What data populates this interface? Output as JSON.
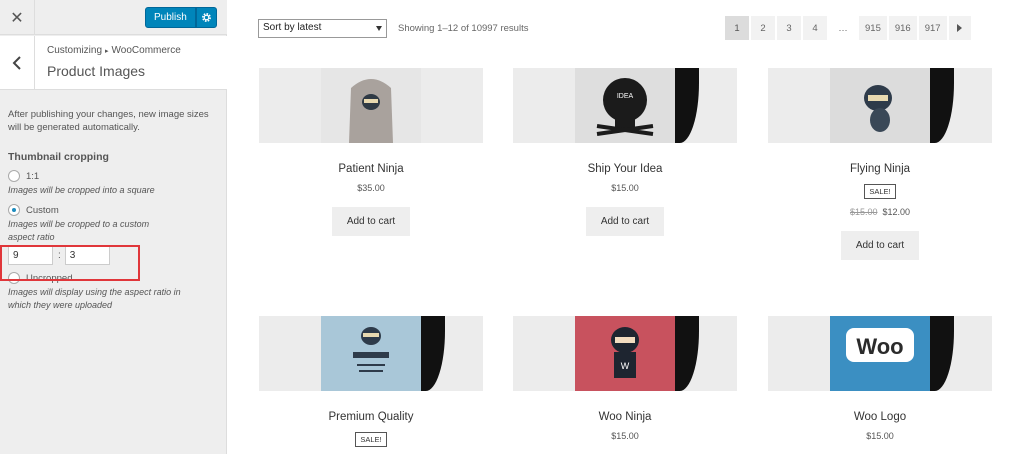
{
  "customizer": {
    "close_icon": "close-icon",
    "publish_label": "Publish",
    "gear_icon": "gear-icon",
    "back_icon": "chevron-left-icon",
    "breadcrumb": {
      "root": "Customizing",
      "separator": "▸",
      "current": "WooCommerce"
    },
    "section_title": "Product Images",
    "note": "After publishing your changes, new image sizes will be generated automatically.",
    "thumbnail_heading": "Thumbnail cropping",
    "options": [
      {
        "label": "1:1",
        "description": "Images will be cropped into a square",
        "checked": false
      },
      {
        "label": "Custom",
        "description": "Images will be cropped to a custom aspect ratio",
        "checked": true
      },
      {
        "label": "Uncropped",
        "description": "Images will display using the aspect ratio in which they were uploaded",
        "checked": false
      }
    ],
    "ratio_width": "9",
    "ratio_separator": ":",
    "ratio_height": "3"
  },
  "shop": {
    "sort_selected": "Sort by latest",
    "results_text": "Showing 1–12 of 10997 results",
    "pagination": [
      "1",
      "2",
      "3",
      "4",
      "…",
      "915",
      "916",
      "917"
    ],
    "current_page": "1",
    "products": [
      {
        "title": "Patient Ninja",
        "price": "$35.00",
        "old_price": "",
        "sale_badge": "",
        "button": "Add to cart",
        "image_bg": "#a9a29d"
      },
      {
        "title": "Ship Your Idea",
        "price": "$15.00",
        "old_price": "",
        "sale_badge": "",
        "button": "Add to cart",
        "image_bg": "#cfcfcf"
      },
      {
        "title": "Flying Ninja",
        "price": "$12.00",
        "old_price": "$15.00",
        "sale_badge": "SALE!",
        "button": "Add to cart",
        "image_bg": "#dcdcdc"
      },
      {
        "title": "Premium Quality",
        "price": "",
        "old_price": "",
        "sale_badge": "SALE!",
        "button": "",
        "image_bg": "#a9c7d8"
      },
      {
        "title": "Woo Ninja",
        "price": "$15.00",
        "old_price": "",
        "sale_badge": "",
        "button": "",
        "image_bg": "#c8525e"
      },
      {
        "title": "Woo Logo",
        "price": "$15.00",
        "old_price": "",
        "sale_badge": "",
        "button": "",
        "image_bg": "#3b8fc2"
      }
    ],
    "woo_logo_text": "Woo"
  },
  "colors": {
    "publish": "#0085ba",
    "highlight": "#e0363a",
    "radio_checked": "#1e8cbe"
  }
}
